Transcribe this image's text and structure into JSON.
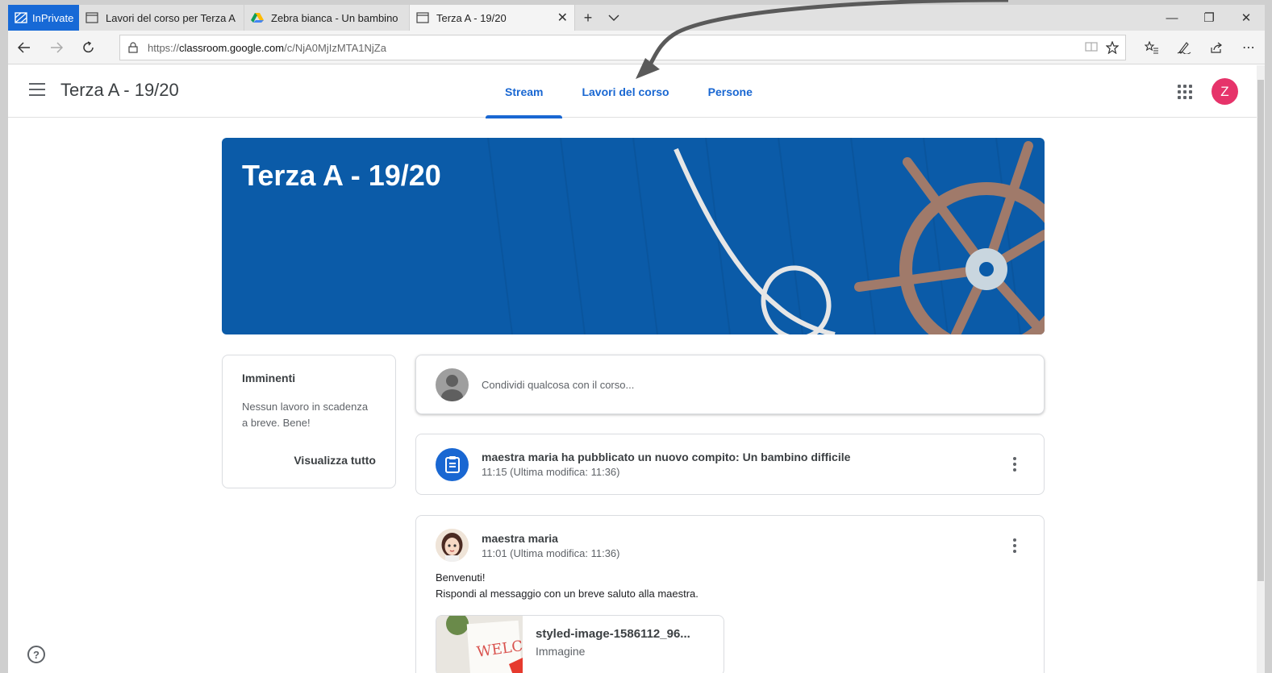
{
  "browser": {
    "inprivate_label": "InPrivate",
    "tabs": [
      {
        "title": "Lavori del corso per Terza A"
      },
      {
        "title": "Zebra bianca - Un bambino"
      },
      {
        "title": "Terza A - 19/20"
      }
    ],
    "url_prefix": "https://",
    "url_domain": "classroom.google.com",
    "url_path": "/c/NjA0MjIzMTA1NjZa"
  },
  "header": {
    "class_title": "Terza A - 19/20",
    "nav": [
      {
        "label": "Stream",
        "active": true
      },
      {
        "label": "Lavori del corso",
        "active": false
      },
      {
        "label": "Persone",
        "active": false
      }
    ],
    "user_initial": "Z",
    "avatar_color": "#e6336a"
  },
  "banner": {
    "title": "Terza A - 19/20",
    "color": "#0b5ba8"
  },
  "upcoming": {
    "title": "Imminenti",
    "message": "Nessun lavoro in scadenza a breve. Bene!",
    "view_all": "Visualizza tutto"
  },
  "share": {
    "placeholder": "Condividi qualcosa con il corso..."
  },
  "posts": [
    {
      "title": "maestra maria ha pubblicato un nuovo compito: Un bambino difficile",
      "time": "11:15 (Ultima modifica: 11:36)"
    },
    {
      "author": "maestra maria",
      "time": "11:01 (Ultima modifica: 11:36)",
      "line1": "Benvenuti!",
      "line2": "Rispondi al messaggio con un breve saluto alla maestra.",
      "attachment": {
        "name": "styled-image-1586112_96...",
        "type": "Immagine",
        "thumb_text": "WELCOME!"
      }
    }
  ],
  "accent_color": "#1967d2"
}
